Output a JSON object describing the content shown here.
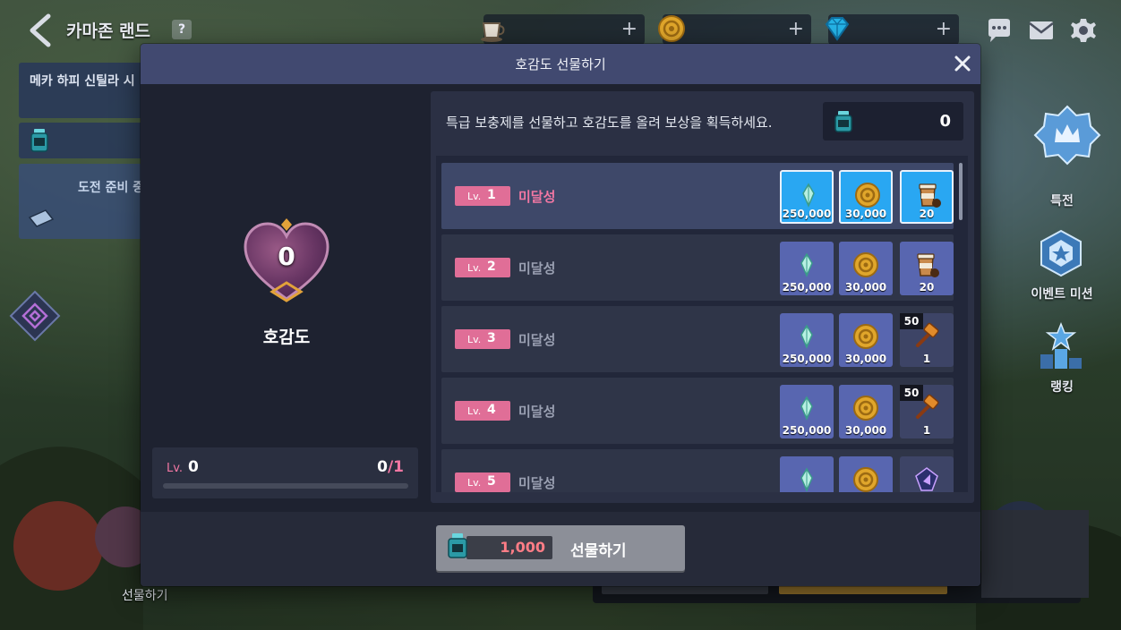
{
  "top_bar": {
    "title": "카마존 랜드",
    "help": "?",
    "currencies": [
      {
        "icon": "coffee-icon",
        "plus": "+"
      },
      {
        "icon": "meso-coin-icon",
        "plus": "+"
      },
      {
        "icon": "gem-icon",
        "plus": "+"
      }
    ]
  },
  "background_hud": {
    "quest_text": "메카 하피 신틸라 시",
    "challenge_text": "도전 준비 중",
    "right_menu": [
      {
        "label": "특전",
        "icon": "crown-badge-icon"
      },
      {
        "label": "이벤트 미션",
        "icon": "mission-hex-icon"
      },
      {
        "label": "랭킹",
        "icon": "ranking-star-icon"
      }
    ],
    "bottom_gift_label": "선물하기"
  },
  "modal": {
    "title": "호감도 선물하기",
    "close": "✕",
    "affinity": {
      "value": "0",
      "label": "호감도",
      "lv_prefix": "Lv.",
      "level": "0",
      "progress_current": "0",
      "progress_sep": "/",
      "progress_max": "1",
      "progress_fraction": 0
    },
    "description": "특급 보충제를 선물하고 호감도를 올려 보상을 획득하세요.",
    "item_count": "0",
    "levels": [
      {
        "lv": "1",
        "status": "미달성",
        "active": true,
        "rewards": [
          {
            "icon": "crystal-icon",
            "qty": "250,000"
          },
          {
            "icon": "meso-coin-icon",
            "qty": "30,000"
          },
          {
            "icon": "coffee-cup-icon",
            "qty": "20"
          }
        ]
      },
      {
        "lv": "2",
        "status": "미달성",
        "active": false,
        "rewards": [
          {
            "icon": "crystal-icon",
            "qty": "250,000"
          },
          {
            "icon": "meso-coin-icon",
            "qty": "30,000"
          },
          {
            "icon": "coffee-cup-icon",
            "qty": "20"
          }
        ]
      },
      {
        "lv": "3",
        "status": "미달성",
        "active": false,
        "rewards": [
          {
            "icon": "crystal-icon",
            "qty": "250,000"
          },
          {
            "icon": "meso-coin-icon",
            "qty": "30,000"
          },
          {
            "icon": "hammer-icon",
            "qty": "1",
            "badge": "50"
          }
        ]
      },
      {
        "lv": "4",
        "status": "미달성",
        "active": false,
        "rewards": [
          {
            "icon": "crystal-icon",
            "qty": "250,000"
          },
          {
            "icon": "meso-coin-icon",
            "qty": "30,000"
          },
          {
            "icon": "hammer-icon",
            "qty": "1",
            "badge": "50"
          }
        ]
      },
      {
        "lv": "5",
        "status": "미달성",
        "active": false,
        "rewards": [
          {
            "icon": "crystal-icon",
            "qty": ""
          },
          {
            "icon": "meso-coin-icon",
            "qty": ""
          },
          {
            "icon": "emblem-icon",
            "qty": ""
          }
        ]
      }
    ],
    "gift_button": {
      "cost": "1,000",
      "label": "선물하기"
    }
  }
}
